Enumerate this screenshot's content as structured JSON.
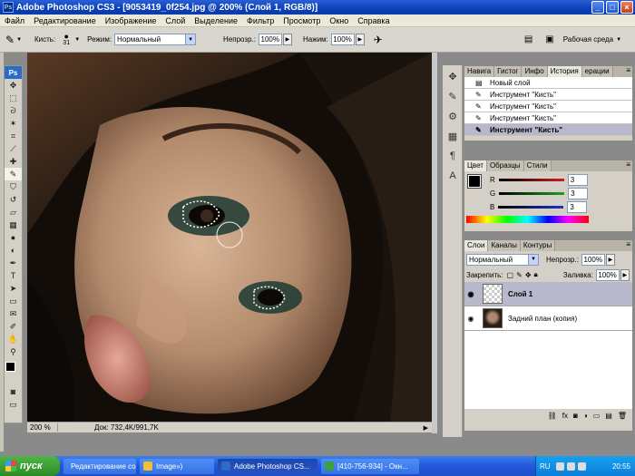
{
  "window": {
    "icon": "Ps",
    "title": "Adobe Photoshop CS3 - [9053419_0f254.jpg @ 200% (Слой 1, RGB/8)]",
    "controls": [
      "_",
      "□",
      "×"
    ]
  },
  "menu": [
    "Файл",
    "Редактирование",
    "Изображение",
    "Слой",
    "Выделение",
    "Фильтр",
    "Просмотр",
    "Окно",
    "Справка"
  ],
  "options": {
    "brush_label": "Кисть:",
    "brush_size": "31",
    "mode_label": "Режим:",
    "mode_value": "Нормальный",
    "opacity_label": "Непрозр.:",
    "opacity_value": "100%",
    "flow_label": "Нажим:",
    "flow_value": "100%",
    "workspace": "Рабочая среда"
  },
  "tools": {
    "logo": "Ps",
    "icons": [
      "move-icon",
      "marquee-icon",
      "lasso-icon",
      "magic-wand-icon",
      "crop-icon",
      "slice-icon",
      "healing-icon",
      "brush-icon",
      "stamp-icon",
      "history-brush-icon",
      "eraser-icon",
      "gradient-icon",
      "blur-icon",
      "dodge-icon",
      "pen-icon",
      "type-icon",
      "path-select-icon",
      "shape-icon",
      "notes-icon",
      "eyedropper-icon",
      "hand-icon",
      "zoom-icon"
    ]
  },
  "status": {
    "zoom": "200 %",
    "doc": "Док: 732,4K/991,7K"
  },
  "history_panel": {
    "tabs": [
      "Навига",
      "Гистог",
      "Инфо",
      "История",
      "ерации"
    ],
    "active_tab": 3,
    "items": [
      {
        "label": "Новый слой",
        "active": false
      },
      {
        "label": "Инструмент \"Кисть\"",
        "active": false
      },
      {
        "label": "Инструмент \"Кисть\"",
        "active": false
      },
      {
        "label": "Инструмент \"Кисть\"",
        "active": false
      },
      {
        "label": "Инструмент \"Кисть\"",
        "active": true
      }
    ]
  },
  "color_panel": {
    "tabs": [
      "Цвет",
      "Образцы",
      "Стили"
    ],
    "channels": [
      {
        "name": "R",
        "value": "3",
        "color": "#cc2020"
      },
      {
        "name": "G",
        "value": "3",
        "color": "#20a020"
      },
      {
        "name": "B",
        "value": "3",
        "color": "#2030cc"
      }
    ]
  },
  "layers_panel": {
    "tabs": [
      "Слои",
      "Каналы",
      "Контуры"
    ],
    "blend_mode": "Нормальный",
    "opacity_label": "Непрозр.:",
    "opacity_value": "100%",
    "lock_label": "Закрепить:",
    "fill_label": "Заливка:",
    "fill_value": "100%",
    "layers": [
      {
        "name": "Слой 1",
        "active": true
      },
      {
        "name": "Задний план (копия)",
        "active": false
      }
    ],
    "footer_icons": [
      "link-icon",
      "fx-icon",
      "mask-icon",
      "adjustment-icon",
      "folder-icon",
      "new-layer-icon",
      "trash-icon"
    ]
  },
  "taskbar": {
    "start": "пуск",
    "tasks": [
      {
        "label": "Редактирование со...",
        "active": false,
        "color": "#e85a20"
      },
      {
        "label": "Image»)",
        "active": false,
        "color": "#f0c030"
      },
      {
        "label": "Adobe Photoshop CS...",
        "active": true,
        "color": "#2a6cc8"
      },
      {
        "label": "[410-756-934] - Окн...",
        "active": false,
        "color": "#3aa040"
      }
    ],
    "lang": "RU",
    "clock": "20:55"
  }
}
